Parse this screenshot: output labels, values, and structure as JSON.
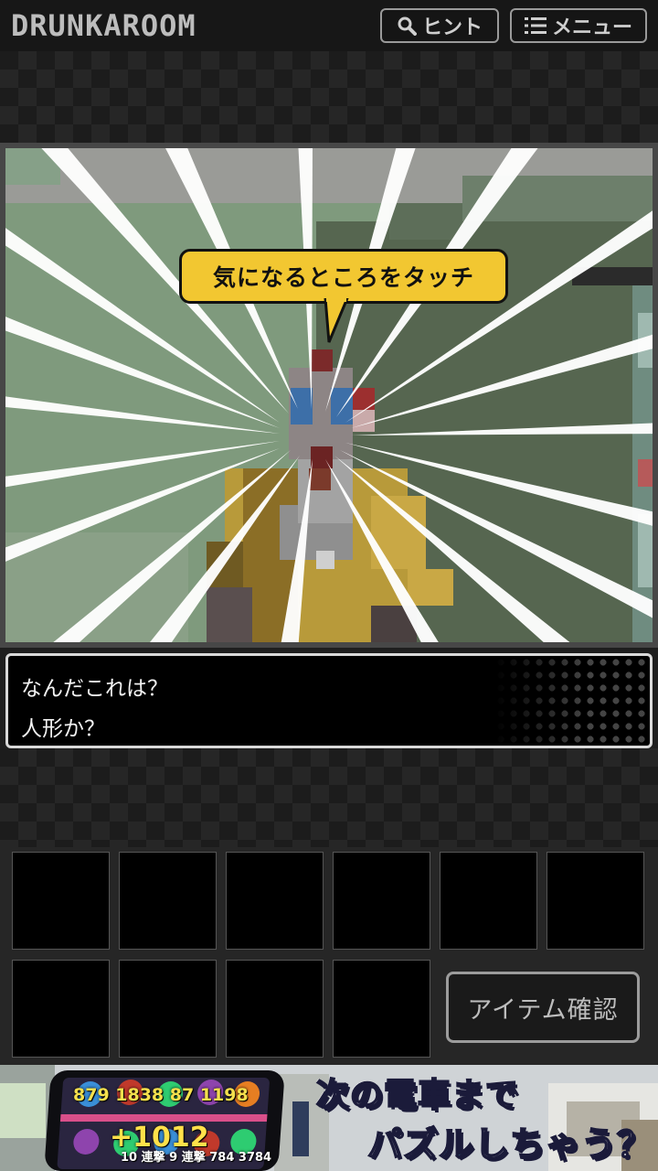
{
  "header": {
    "logo": "DRUNKAROOM",
    "hint_label": "ヒント",
    "menu_label": "メニュー"
  },
  "scene": {
    "bubble_text": "気になるところをタッチ"
  },
  "dialog": {
    "line1": "なんだこれは？",
    "line2": "人形か？"
  },
  "inventory": {
    "slot_count": 10,
    "check_button": "アイテム確認"
  },
  "ad": {
    "numbers_top": "879 1838 87 1198",
    "numbers_big": "+1012",
    "numbers_small": "10 連撃  9 連撃  784 3784",
    "line1": "次の電車まで",
    "line2_a": "パズ",
    "line2_b": "ル",
    "line2_c": "しちゃう？"
  },
  "colors": {
    "bubble": "#f2c731",
    "dialog_border": "#d9d9d9",
    "wall": "#7f9a7d"
  }
}
